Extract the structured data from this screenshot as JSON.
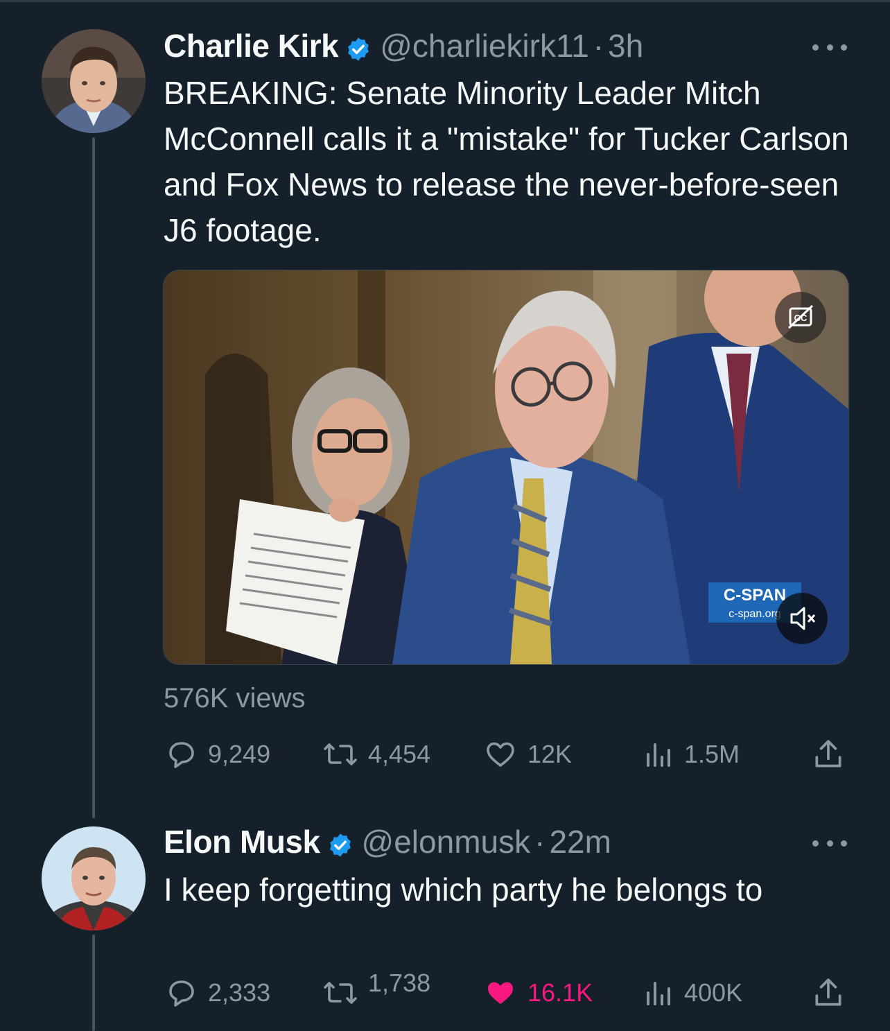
{
  "tweets": [
    {
      "name": "Charlie Kirk",
      "handle": "@charliekirk11",
      "separator": "·",
      "time": "3h",
      "text": "BREAKING: Senate Minority Leader Mitch McConnell calls it a \"mistake\" for Tucker Carlson and Fox News to release the never-before-seen J6 footage.",
      "media": {
        "watermark_title": "C-SPAN",
        "watermark_url": "c-span.org",
        "cc_icon": "closed-captions-off-icon",
        "mute_icon": "muted-speaker-icon"
      },
      "views": "576K views",
      "stats": {
        "replies": "9,249",
        "retweets": "4,454",
        "likes": "12K",
        "analytics": "1.5M"
      }
    },
    {
      "name": "Elon Musk",
      "handle": "@elonmusk",
      "separator": "·",
      "time": "22m",
      "text": "I keep forgetting which party he belongs to",
      "stats": {
        "replies": "2,333",
        "retweets": "1,738",
        "likes": "16.1K",
        "analytics": "400K"
      },
      "liked": true
    }
  ],
  "colors": {
    "background": "#15202b",
    "muted": "#8b98a5",
    "verified": "#1d9bf0",
    "like": "#f91880"
  }
}
